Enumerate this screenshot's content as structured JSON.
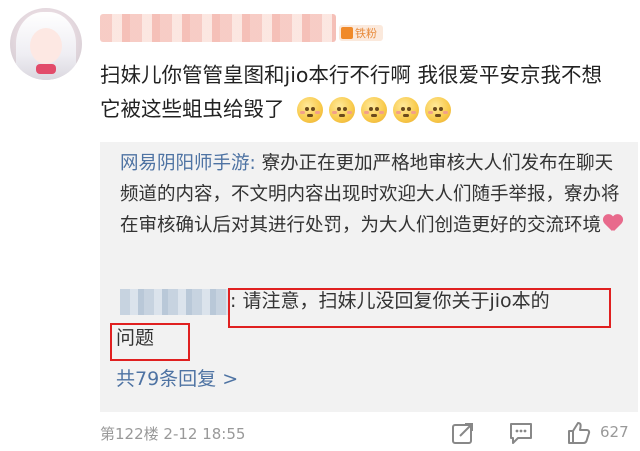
{
  "comment": {
    "fan_badge": "铁粉",
    "text": "扫妹儿你管管皇图和jio本行不行啊 我很爱平安京我不想它被这些蛆虫给毁了",
    "emoji_count": 5
  },
  "reply": {
    "official_name": "网易阴阳师手游:",
    "official_text": " 寮办正在更加严格地审核大人们发布在聊天频道的内容，不文明内容出现时欢迎大人们随手举报，寮办将在审核确认后对其进行处罚，为大人们创造更好的交流环境",
    "second_line1": ": 请注意，扫妹儿没回复你关于jio本的",
    "second_line2": "问题",
    "more": "共79条回复 >"
  },
  "footer": {
    "meta": "第122楼  2-12 18:55",
    "likes": "627"
  },
  "colors": {
    "link": "#4e73a3",
    "highlight": "#e02020",
    "reply_bg": "#f2f2f2"
  }
}
